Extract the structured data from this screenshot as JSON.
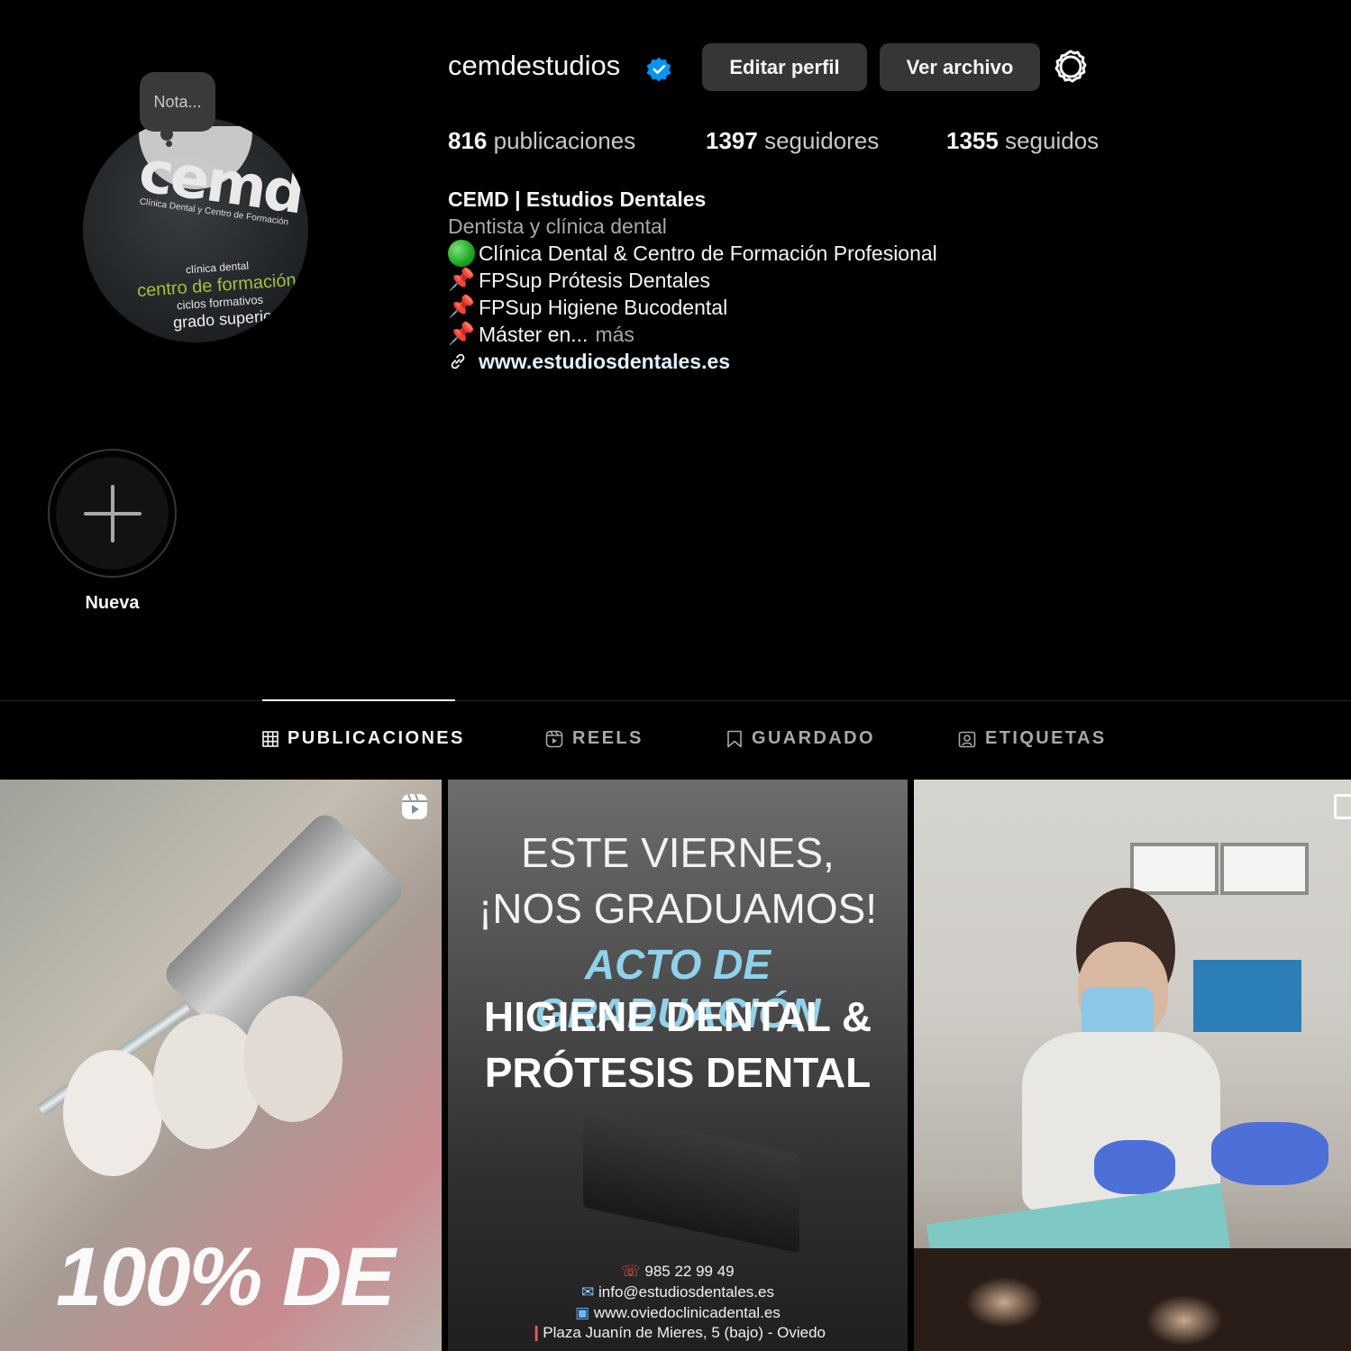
{
  "profile": {
    "note": "Nota...",
    "username": "cemdestudios",
    "buttons": {
      "edit": "Editar perfil",
      "archive": "Ver archivo"
    },
    "stats": [
      {
        "value": "816",
        "label": "publicaciones"
      },
      {
        "value": "1397",
        "label": "seguidores"
      },
      {
        "value": "1355",
        "label": "seguidos"
      }
    ],
    "bio": {
      "name": "CEMD | Estudios Dentales",
      "category": "Dentista y clínica dental",
      "lines": [
        "Clínica Dental & Centro de Formación Profesional",
        "FPSup Prótesis Dentales",
        "FPSup Higiene Bucodental",
        "Máster en..."
      ],
      "more": "más",
      "link": "www.estudiosdentales.es"
    },
    "avatar_text": {
      "logo": "cemd",
      "sub": "Clínica Dental y Centro de Formación",
      "l1": "clínica dental",
      "l2": "centro de formación",
      "l3": "ciclos formativos",
      "l4": "grado superior"
    }
  },
  "highlight": {
    "label": "Nueva"
  },
  "tabs": [
    {
      "label": "PUBLICACIONES",
      "icon": "grid-icon",
      "active": true
    },
    {
      "label": "REELS",
      "icon": "reels-icon",
      "active": false
    },
    {
      "label": "GUARDADO",
      "icon": "bookmark-icon",
      "active": false
    },
    {
      "label": "ETIQUETAS",
      "icon": "tagged-icon",
      "active": false
    }
  ],
  "posts": {
    "p1": {
      "overlay": "100%  DE"
    },
    "p2": {
      "line1": "ESTE VIERNES,",
      "line2": "¡NOS GRADUAMOS!",
      "line3": "ACTO DE GRADUACIÓN",
      "line4": "HIGIENE DENTAL &",
      "line5": "PRÓTESIS DENTAL",
      "phone": "985 22 99 49",
      "email": "info@estudiosdentales.es",
      "web": "www.oviedoclinicadental.es",
      "address": "Plaza Juanín de Mieres, 5 (bajo) - Oviedo"
    }
  },
  "colors": {
    "verified": "#0095f6",
    "button_bg": "#363636",
    "accent_blue": "#8fd2ea"
  }
}
